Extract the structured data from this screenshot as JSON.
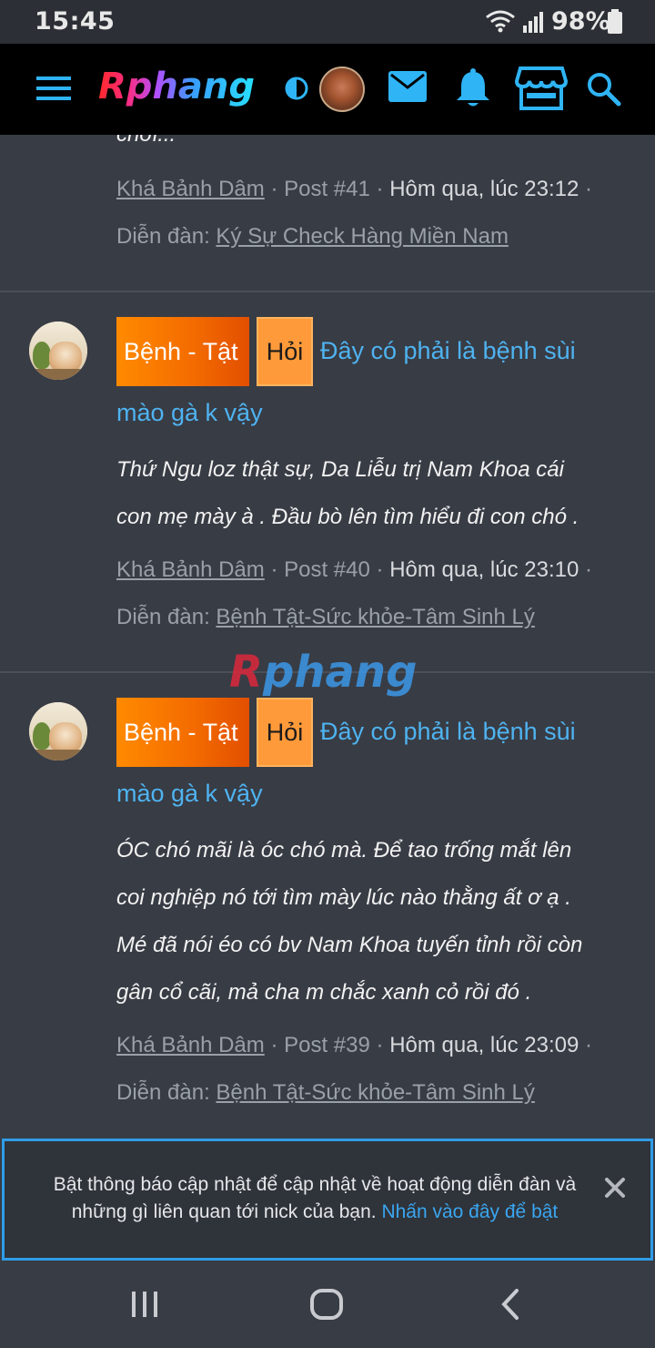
{
  "status_bar": {
    "time": "15:45",
    "battery": "98%",
    "icons": [
      "wifi-icon",
      "signal-icon",
      "battery-icon"
    ]
  },
  "header": {
    "logo": "Rphang",
    "icons": [
      "menu-icon",
      "theme-toggle-icon",
      "avatar",
      "mail-icon",
      "bell-icon",
      "store-icon",
      "search-icon"
    ],
    "accent_color": "#2fb4f5"
  },
  "feed": {
    "top_truncated_text": "chơi...",
    "posts": [
      {
        "author": "Khá Bảnh Dâm",
        "post_no": "Post #41",
        "date": "Hôm qua, lúc 23:12",
        "forum_label": "Diễn đàn:",
        "forum": "Ký Sự Check Hàng Miền Nam"
      },
      {
        "tag_primary": "Bệnh - Tật",
        "tag_secondary": "Hỏi",
        "title_line1": "Đây có phải là bệnh sùi",
        "title_line2": "mào gà k vậy",
        "body": [
          "Thứ Ngu loz thật sự, Da Liễu trị Nam Khoa cái",
          "con mẹ mày à . Đầu bò lên tìm hiểu đi con chó ."
        ],
        "author": "Khá Bảnh Dâm",
        "post_no": "Post #40",
        "date": "Hôm qua, lúc 23:10",
        "forum_label": "Diễn đàn:",
        "forum": "Bệnh Tật-Sức khỏe-Tâm Sinh Lý"
      },
      {
        "tag_primary": "Bệnh - Tật",
        "tag_secondary": "Hỏi",
        "title_line1": "Đây có phải là bệnh sùi",
        "title_line2": "mào gà k vậy",
        "body": [
          "ÓC chó mãi là óc chó mà. Để tao trống mắt lên",
          "coi nghiệp nó tới tìm mày lúc nào thằng ất ơ ạ .",
          "Mé đã nói éo có bv Nam Khoa tuyến tỉnh rồi còn",
          "gân cổ cãi, mả cha m chắc xanh cỏ rồi đó ."
        ],
        "author": "Khá Bảnh Dâm",
        "post_no": "Post #39",
        "date": "Hôm qua, lúc 23:09",
        "forum_label": "Diễn đàn:",
        "forum": "Bệnh Tật-Sức khỏe-Tâm Sinh Lý"
      }
    ],
    "watermark_a": "R",
    "watermark_b": "phang"
  },
  "notice": {
    "text": "Bật thông báo cập nhật để cập nhật về hoạt động diễn đàn và những gì liên quan tới nick của bạn.",
    "link": "Nhấn vào đây để bật"
  },
  "separator": "·",
  "nav_icons": [
    "recent-apps-icon",
    "home-icon",
    "back-icon"
  ]
}
